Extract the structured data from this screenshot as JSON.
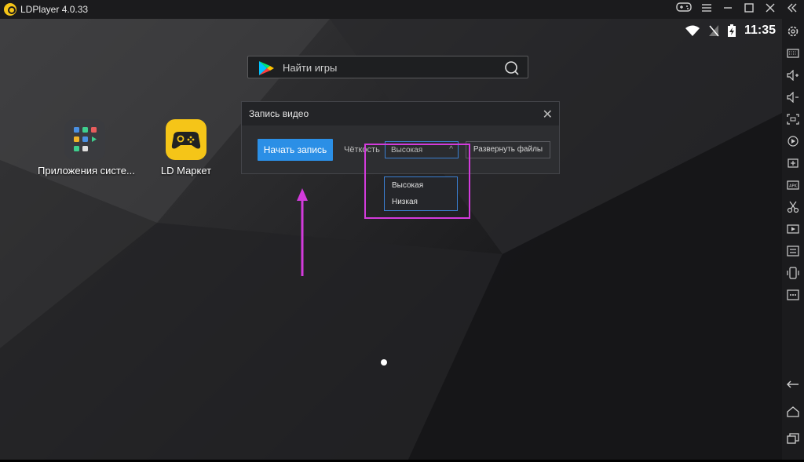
{
  "window": {
    "title": "LDPlayer 4.0.33"
  },
  "status": {
    "time": "11:35"
  },
  "search": {
    "placeholder": "Найти игры"
  },
  "desktop": {
    "apps": [
      {
        "label": "Приложения систе..."
      },
      {
        "label": "LD Маркет"
      }
    ]
  },
  "dialog": {
    "title": "Запись видео",
    "record_button": "Начать запись",
    "quality_label": "Чёткость",
    "quality_selected": "Высокая",
    "quality_options": [
      "Высокая",
      "Низкая"
    ],
    "expand_button": "Развернуть файлы"
  },
  "colors": {
    "accent_blue": "#2b8fe6",
    "highlight_magenta": "#d33bdc",
    "ld_yellow": "#f5c518"
  },
  "sidebar_icons": [
    "settings-icon",
    "keyboard-icon",
    "volume-up-icon",
    "volume-down-icon",
    "screenshot-icon",
    "record-icon",
    "add-apk-icon",
    "apk-icon",
    "scissors-icon",
    "video-icon",
    "sync-icon",
    "rotate-icon",
    "more-icon",
    "back-icon",
    "home-icon",
    "recents-icon"
  ]
}
